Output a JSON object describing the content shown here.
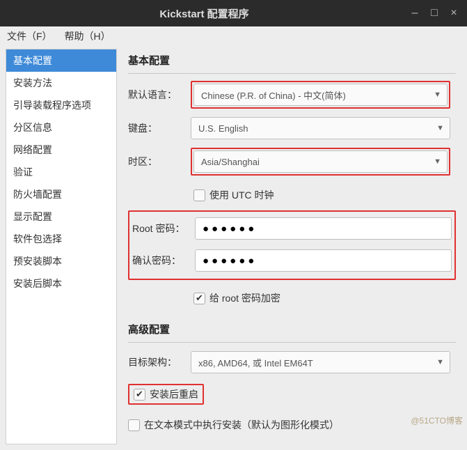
{
  "window": {
    "title": "Kickstart 配置程序"
  },
  "menu": {
    "file": "文件（F）",
    "help": "帮助（H）"
  },
  "sidebar": {
    "items": [
      "基本配置",
      "安装方法",
      "引导装载程序选项",
      "分区信息",
      "网络配置",
      "验证",
      "防火墙配置",
      "显示配置",
      "软件包选择",
      "预安装脚本",
      "安装后脚本"
    ]
  },
  "basic": {
    "title": "基本配置",
    "lang_label": "默认语言：",
    "lang_value": "Chinese (P.R. of China) - 中文(简体)",
    "keyboard_label": "键盘：",
    "keyboard_value": "U.S. English",
    "tz_label": "时区：",
    "tz_value": "Asia/Shanghai",
    "utc_label": "使用  UTC 时钟",
    "root_label": "Root 密码：",
    "root_value": "●●●●●●",
    "confirm_label": "确认密码：",
    "confirm_value": "●●●●●●",
    "encrypt_label": "给 root 密码加密"
  },
  "advanced": {
    "title": "高级配置",
    "arch_label": "目标架构：",
    "arch_value": "x86, AMD64, 或 Intel EM64T",
    "reboot_label": "安装后重启",
    "textmode_label": "在文本模式中执行安装（默认为图形化模式）"
  },
  "watermark": "@51CTO博客"
}
